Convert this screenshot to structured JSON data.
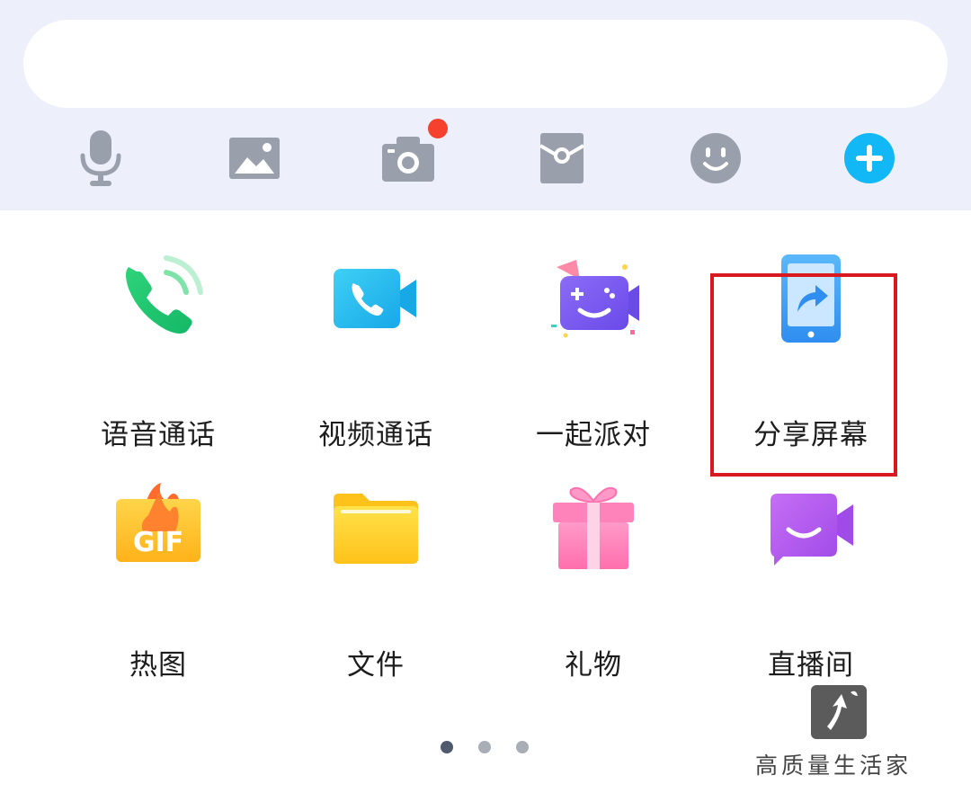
{
  "input_bar": {
    "placeholder": ""
  },
  "toolbar": {
    "items": [
      {
        "name": "microphone-icon"
      },
      {
        "name": "image-icon"
      },
      {
        "name": "camera-icon",
        "has_badge": true
      },
      {
        "name": "red-packet-icon"
      },
      {
        "name": "emoji-icon"
      },
      {
        "name": "plus-icon"
      }
    ],
    "badge_color": "#f5412d",
    "accent_color": "#12b7f5"
  },
  "features": [
    {
      "label": "语音通话",
      "icon": "voice-call-icon"
    },
    {
      "label": "视频通话",
      "icon": "video-call-icon"
    },
    {
      "label": "一起派对",
      "icon": "party-icon"
    },
    {
      "label": "分享屏幕",
      "icon": "share-screen-icon",
      "highlighted": true
    },
    {
      "label": "热图",
      "icon": "gif-icon",
      "icon_text": "GIF"
    },
    {
      "label": "文件",
      "icon": "folder-icon"
    },
    {
      "label": "礼物",
      "icon": "gift-icon"
    },
    {
      "label": "直播间",
      "icon": "live-room-icon"
    }
  ],
  "pagination": {
    "pages": 3,
    "current": 1
  },
  "highlight_color": "#d8191f",
  "watermark": {
    "text": "高质量生活家"
  }
}
